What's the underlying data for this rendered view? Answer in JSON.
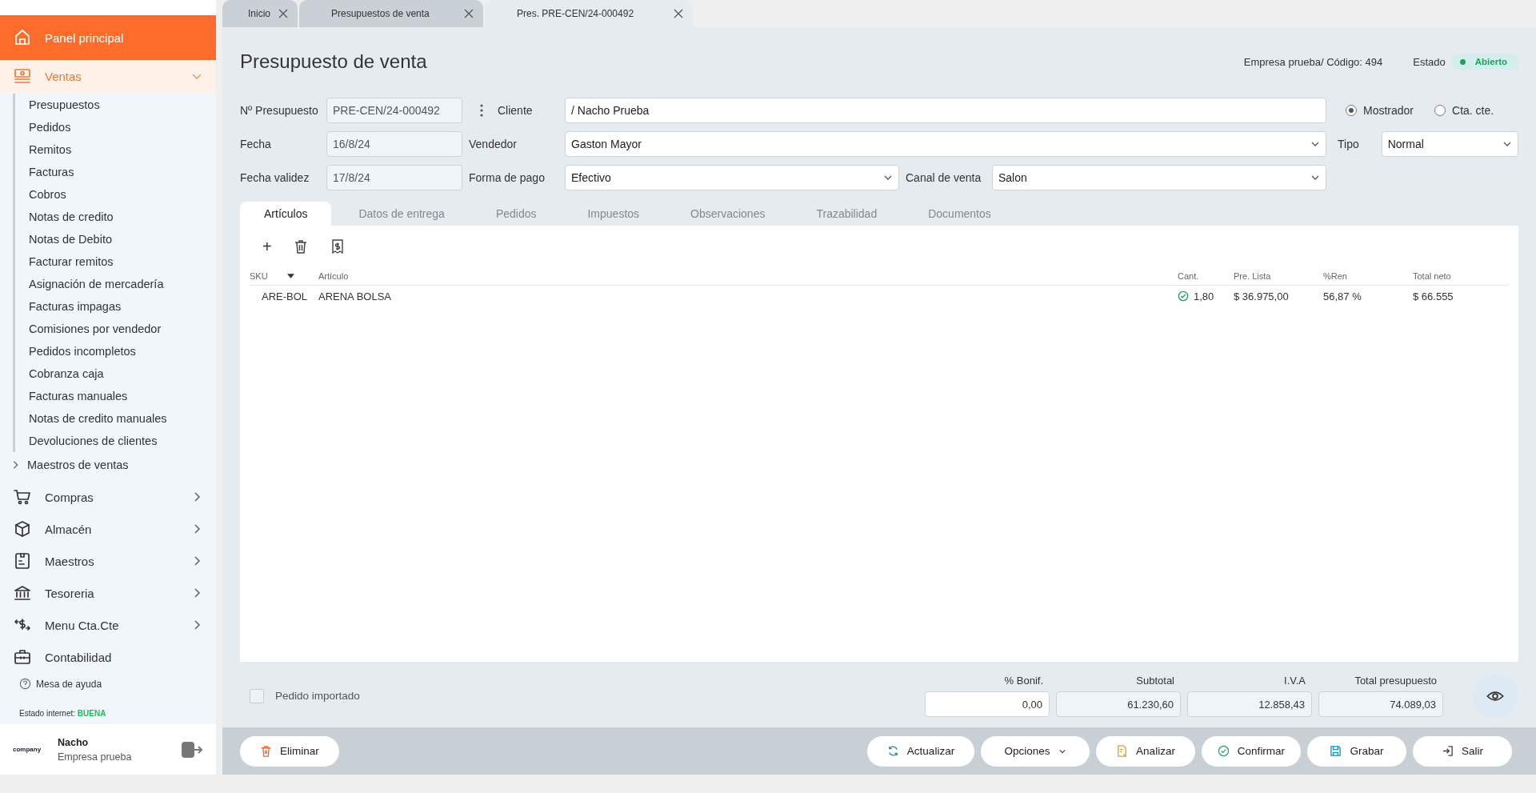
{
  "sidebar": {
    "items": [
      {
        "label": "Panel principal",
        "kind": "link",
        "selected": true
      },
      {
        "label": "Ventas",
        "kind": "group",
        "selected": false,
        "expanded": true,
        "children": [
          {
            "label": "Presupuestos",
            "kind": "link"
          },
          {
            "label": "Pedidos",
            "kind": "link"
          },
          {
            "label": "Remitos",
            "kind": "link"
          },
          {
            "label": "Facturas",
            "kind": "link"
          },
          {
            "label": "Cobros",
            "kind": "link"
          },
          {
            "label": "Notas de credito",
            "kind": "link"
          },
          {
            "label": "Notas de Debito",
            "kind": "link"
          },
          {
            "label": "Facturar remitos",
            "kind": "link"
          },
          {
            "label": "Asignación de mercadería",
            "kind": "link"
          },
          {
            "label": "Facturas impagas",
            "kind": "link"
          },
          {
            "label": "Comisiones por vendedor",
            "kind": "link"
          },
          {
            "label": "Pedidos incompletos",
            "kind": "link"
          },
          {
            "label": "Cobranza caja",
            "kind": "link"
          },
          {
            "label": "Facturas manuales",
            "kind": "link"
          },
          {
            "label": "Notas de credito manuales",
            "kind": "link"
          },
          {
            "label": "Devoluciones de clientes",
            "kind": "link"
          },
          {
            "label": "Maestros de ventas",
            "kind": "group",
            "expanded": false
          }
        ]
      },
      {
        "label": "Compras",
        "kind": "group",
        "selected": false,
        "expanded": false
      },
      {
        "label": "Almacén",
        "kind": "group",
        "selected": false,
        "expanded": false
      },
      {
        "label": "Maestros",
        "kind": "group",
        "selected": false,
        "expanded": false
      },
      {
        "label": "Tesoreria",
        "kind": "group",
        "selected": false,
        "expanded": false
      },
      {
        "label": "Menu Cta.Cte",
        "kind": "group",
        "selected": false,
        "expanded": false
      },
      {
        "label": "Contabilidad",
        "kind": "link",
        "selected": false
      }
    ],
    "help": "Mesa de ayuda",
    "internet": {
      "label": "Estado internet:",
      "value": "BUENA"
    },
    "user": {
      "logo": "company",
      "name": "Nacho",
      "company": "Empresa prueba"
    }
  },
  "tabs": [
    {
      "label": "Inicio",
      "selected": false
    },
    {
      "label": "Presupuestos de venta",
      "selected": false
    },
    {
      "label": "Pres. PRE-CEN/24-000492",
      "selected": true
    }
  ],
  "title": "Presupuesto de venta",
  "company_code": "Empresa prueba/ Código: 494",
  "status": {
    "label": "Estado",
    "value": "Abierto"
  },
  "form": {
    "numero": {
      "label": "Nº Presupuesto",
      "value": "PRE-CEN/24-000492"
    },
    "cliente": {
      "label": "Cliente",
      "value": "/ Nacho Prueba"
    },
    "client_type": [
      {
        "label": "Mostrador",
        "selected": true
      },
      {
        "label": "Cta. cte.",
        "selected": false
      }
    ],
    "fecha": {
      "label": "Fecha",
      "value": "16/8/24"
    },
    "vendedor": {
      "label": "Vendedor",
      "value": "Gaston Mayor"
    },
    "tipo": {
      "label": "Tipo",
      "value": "Normal"
    },
    "fecha_validez": {
      "label": "Fecha validez",
      "value": "17/8/24"
    },
    "forma_pago": {
      "label": "Forma de pago",
      "value": "Efectivo"
    },
    "canal": {
      "label": "Canal de venta",
      "value": "Salon"
    }
  },
  "detail_tabs": [
    {
      "label": "Artículos",
      "selected": true
    },
    {
      "label": "Datos de entrega",
      "selected": false
    },
    {
      "label": "Pedidos",
      "selected": false
    },
    {
      "label": "Impuestos",
      "selected": false
    },
    {
      "label": "Observaciones",
      "selected": false
    },
    {
      "label": "Trazabilidad",
      "selected": false
    },
    {
      "label": "Documentos",
      "selected": false
    }
  ],
  "add_label": "+",
  "table": {
    "columns": [
      "SKU",
      "Artículo",
      "Cant.",
      "Pre. Lista",
      "%Ren",
      "Total neto"
    ],
    "rows": [
      {
        "sku": "ARE-BOL",
        "article": "ARENA BOLSA",
        "confirmed": true,
        "qty": "1,80",
        "price": "$ 36.975,00",
        "ren": "56,87 %",
        "total": "$ 66.555"
      }
    ]
  },
  "imported": {
    "label": "Pedido importado",
    "checked": false
  },
  "totals": [
    {
      "label": "% Bonif.",
      "value": "0,00",
      "editable": true
    },
    {
      "label": "Subtotal",
      "value": "61.230,60",
      "editable": false
    },
    {
      "label": "I.V.A",
      "value": "12.858,43",
      "editable": false
    },
    {
      "label": "Total presupuesto",
      "value": "74.089,03",
      "editable": false
    }
  ],
  "buttons": [
    {
      "label": "Eliminar",
      "kind": "delete"
    },
    {
      "label": "Actualizar",
      "kind": "refresh"
    },
    {
      "label": "Opciones",
      "kind": "menu"
    },
    {
      "label": "Analizar",
      "kind": "analyze"
    },
    {
      "label": "Confirmar",
      "kind": "confirm"
    },
    {
      "label": "Grabar",
      "kind": "save"
    },
    {
      "label": "Salir",
      "kind": "exit"
    }
  ]
}
